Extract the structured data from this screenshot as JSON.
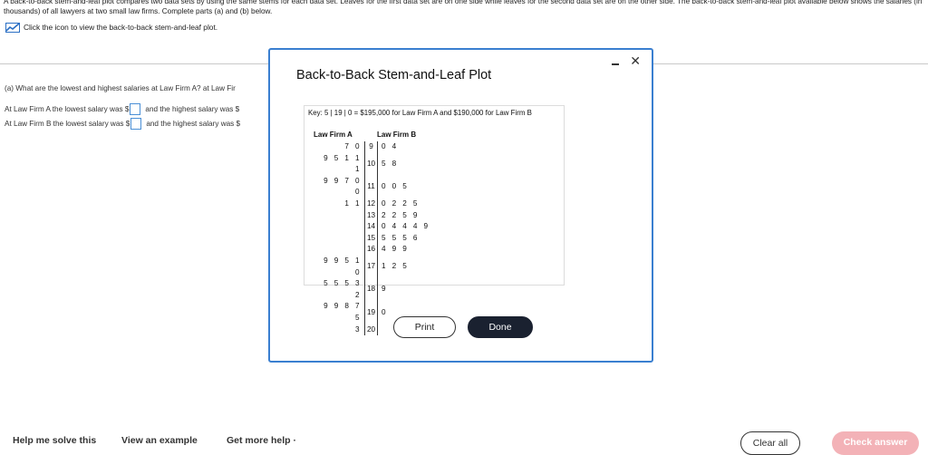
{
  "intro": {
    "text": "A back-to-back stem-and-leaf plot compares two data sets by using the same stems for each data set. Leaves for the first data set are on one side while leaves for the second data set are on the other side. The back-to-back stem-and-leaf plot available below shows the salaries (in thousands) of all lawyers at two small law firms. Complete parts (a) and (b) below.",
    "link_label": "Click the icon to view the back-to-back stem-and-leaf plot."
  },
  "question": {
    "part_a": "(a) What are the lowest and highest salaries at Law Firm A? at Law Fir",
    "line1_prefix": "At Law Firm A the lowest salary was $",
    "line1_suffix": "and the highest salary was $",
    "line2_prefix": "At Law Firm B the lowest salary was $",
    "line2_suffix": "and the highest salary was $"
  },
  "modal": {
    "title": "Back-to-Back Stem-and-Leaf Plot",
    "key": "Key: 5 | 19 | 0 = $195,000 for Law Firm A and $190,000 for Law Firm B",
    "header_a": "Law Firm A",
    "header_b": "Law Firm B",
    "rows": [
      {
        "a": "7 0",
        "stem": "9",
        "b": "0 4"
      },
      {
        "a": "9 5 1 1 1",
        "stem": "10",
        "b": "5 8"
      },
      {
        "a": "9 9 7 0 0",
        "stem": "11",
        "b": "0 0 5"
      },
      {
        "a": "1 1",
        "stem": "12",
        "b": "0 2 2 5"
      },
      {
        "a": "",
        "stem": "13",
        "b": "2 2 5 9"
      },
      {
        "a": "",
        "stem": "14",
        "b": "0 4 4 4 9"
      },
      {
        "a": "",
        "stem": "15",
        "b": "5 5 5 6"
      },
      {
        "a": "",
        "stem": "16",
        "b": "4 9 9"
      },
      {
        "a": "9 9 5 1 0",
        "stem": "17",
        "b": "1 2 5"
      },
      {
        "a": "5 5 5 3 2",
        "stem": "18",
        "b": "9"
      },
      {
        "a": "9 9 8 7 5",
        "stem": "19",
        "b": "0"
      },
      {
        "a": "3",
        "stem": "20",
        "b": ""
      }
    ],
    "print_label": "Print",
    "done_label": "Done"
  },
  "bottom": {
    "help_label": "Help me solve this",
    "example_label": "View an example",
    "more_help_label": "Get more help ·",
    "clear_label": "Clear all",
    "check_label": "Check answer"
  },
  "colors": {
    "accent": "#3a7fd0",
    "done_bg": "#1a2130",
    "check_bg": "#f3b2b7",
    "link_icon": "#2a6fc4"
  },
  "icons": [
    "chart-icon",
    "minimize-icon",
    "close-icon"
  ]
}
